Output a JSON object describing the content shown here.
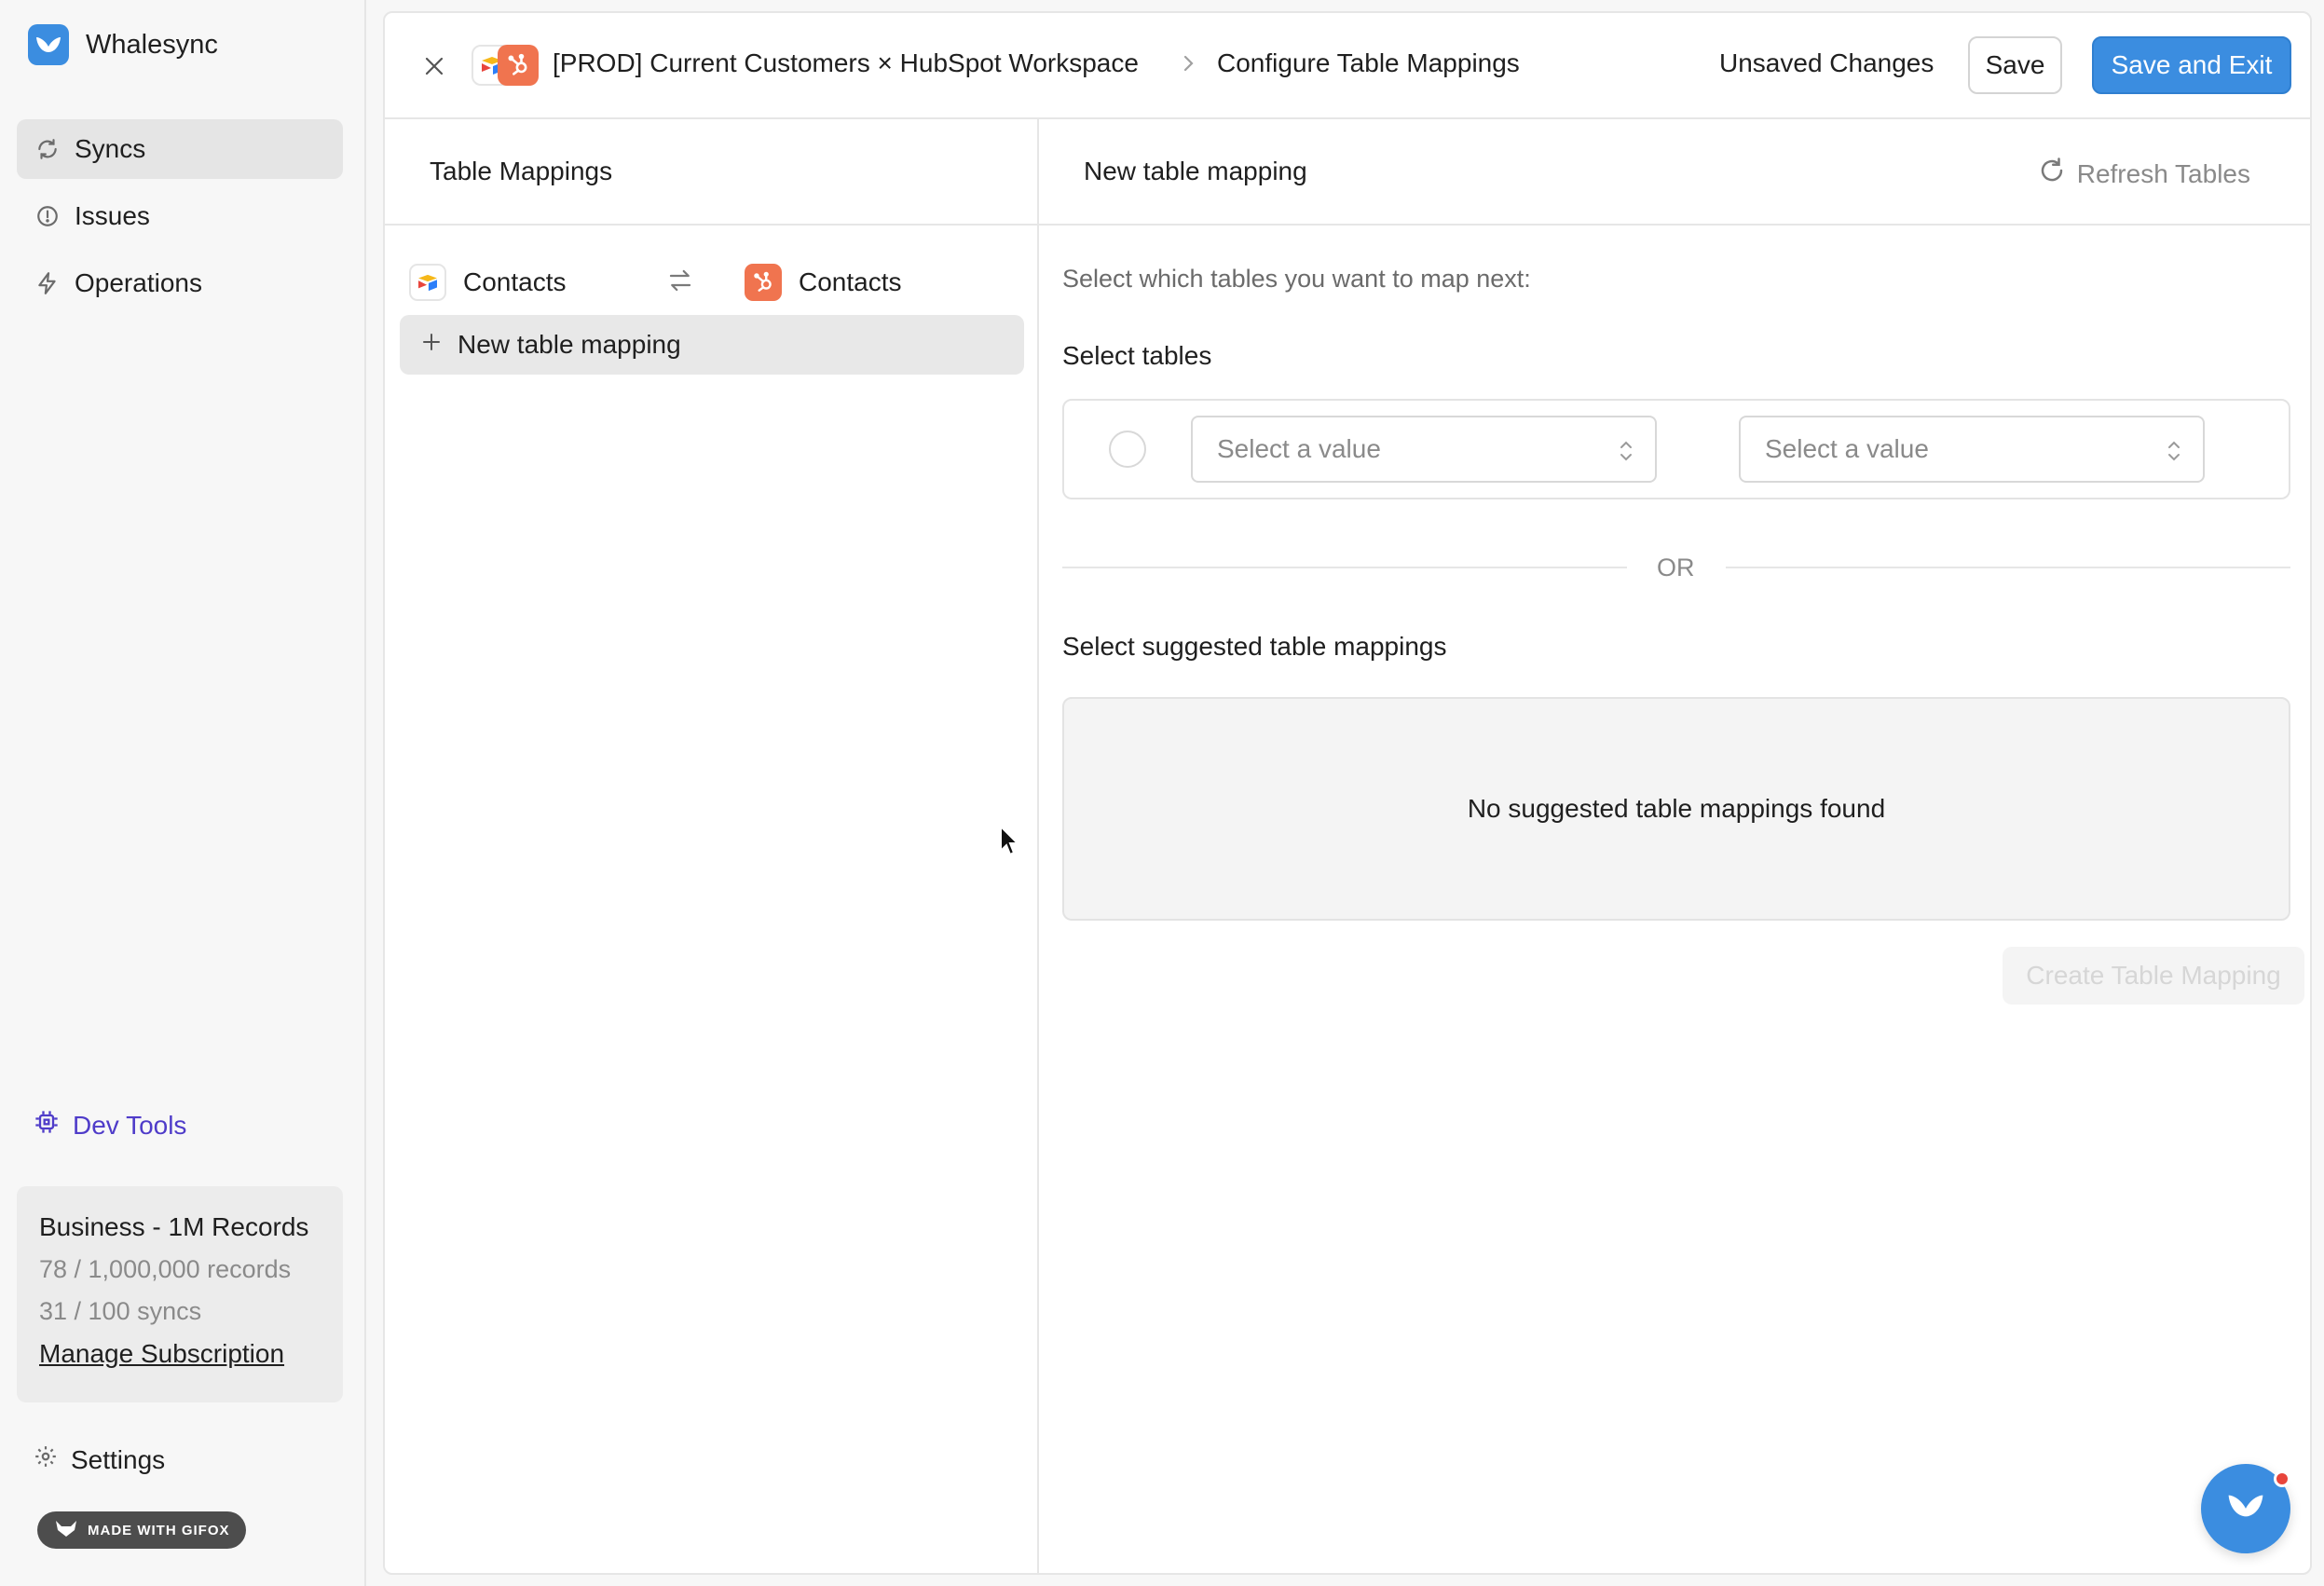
{
  "app": {
    "name": "Whalesync",
    "brand_color": "#3b8de0"
  },
  "sidebar": {
    "nav": [
      {
        "label": "Syncs",
        "icon": "refresh-icon",
        "active": true
      },
      {
        "label": "Issues",
        "icon": "alert-circle-icon",
        "active": false
      },
      {
        "label": "Operations",
        "icon": "lightning-icon",
        "active": false
      }
    ],
    "devtools_label": "Dev Tools",
    "plan": {
      "title": "Business - 1M Records",
      "records": "78 / 1,000,000 records",
      "syncs": "31 / 100 syncs",
      "manage_link": "Manage Subscription"
    },
    "settings_label": "Settings",
    "watermark": "MADE WITH GIFOX"
  },
  "header": {
    "breadcrumb_sync": "[PROD] Current Customers × HubSpot Workspace",
    "breadcrumb_page": "Configure Table Mappings",
    "status": "Unsaved Changes",
    "save_label": "Save",
    "save_exit_label": "Save and Exit"
  },
  "left_panel": {
    "title": "Table Mappings",
    "mappings": [
      {
        "left": "Contacts",
        "right": "Contacts"
      }
    ],
    "new_mapping_label": "New table mapping"
  },
  "right_panel": {
    "title": "New table mapping",
    "refresh_label": "Refresh Tables",
    "instructions": "Select which tables you want to map next:",
    "select_tables_label": "Select tables",
    "left_select_placeholder": "Select a value",
    "right_select_placeholder": "Select a value",
    "or_label": "OR",
    "suggested_label": "Select suggested table mappings",
    "empty_suggestions": "No suggested table mappings found",
    "create_label": "Create Table Mapping"
  },
  "colors": {
    "hubspot": "#f0744f",
    "accent": "#3b8de0",
    "devtools": "#4f3cc9",
    "notification": "#e8453c"
  }
}
